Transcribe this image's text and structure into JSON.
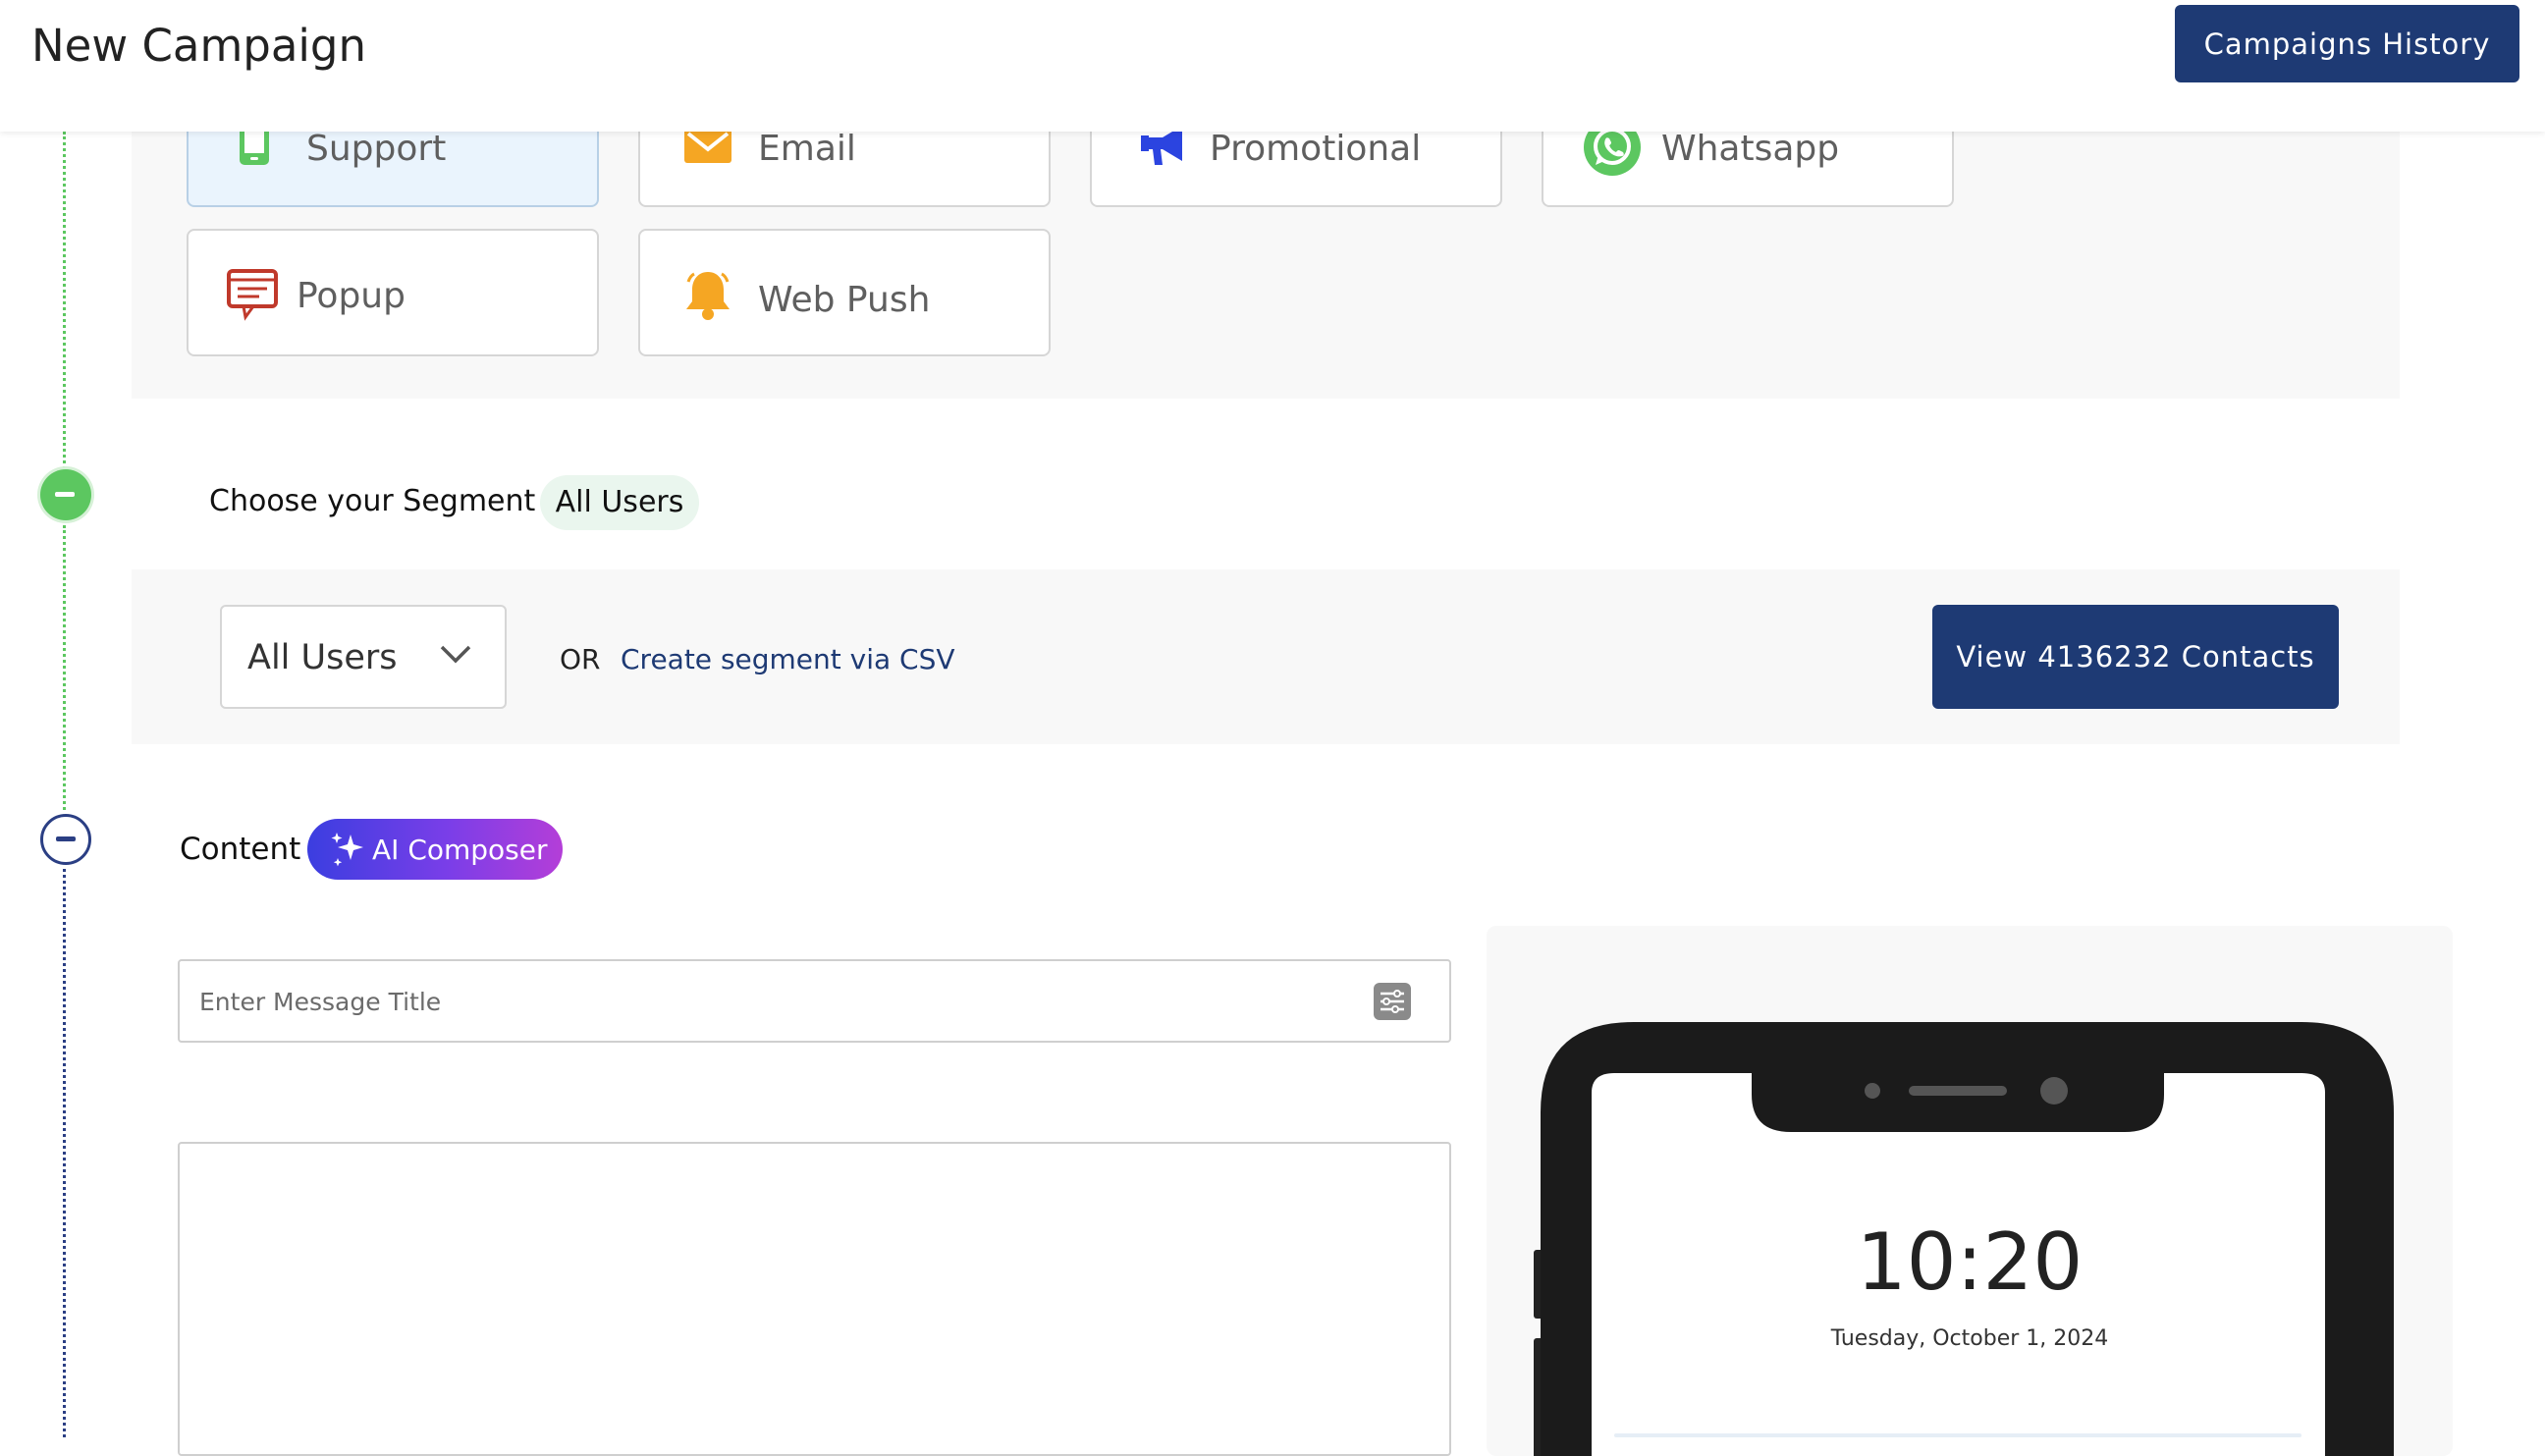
{
  "header": {
    "title": "New Campaign",
    "history_button": "Campaigns History"
  },
  "channels": [
    {
      "label": "Support",
      "icon": "phone-icon",
      "selected": true
    },
    {
      "label": "Email",
      "icon": "envelope-icon",
      "selected": false
    },
    {
      "label": "Promotional",
      "icon": "megaphone-icon",
      "selected": false
    },
    {
      "label": "Whatsapp",
      "icon": "whatsapp-icon",
      "selected": false
    },
    {
      "label": "Popup",
      "icon": "popup-message-icon",
      "selected": false
    },
    {
      "label": "Web Push",
      "icon": "bell-icon",
      "selected": false
    }
  ],
  "segment": {
    "label": "Choose your Segment",
    "selected_pill": "All Users",
    "dropdown_value": "All Users",
    "or_text": "OR",
    "csv_link": "Create segment via CSV",
    "view_button": "View 4136232 Contacts"
  },
  "content": {
    "label": "Content",
    "ai_button": "AI Composer",
    "title_placeholder": "Enter Message Title"
  },
  "preview": {
    "time": "10:20",
    "date": "Tuesday, October 1, 2024"
  },
  "colors": {
    "primary": "#1e3a74",
    "timeline_green": "#5cc760",
    "timeline_blue": "#2b3f84",
    "selected_card_bg": "#eaf4fd"
  }
}
